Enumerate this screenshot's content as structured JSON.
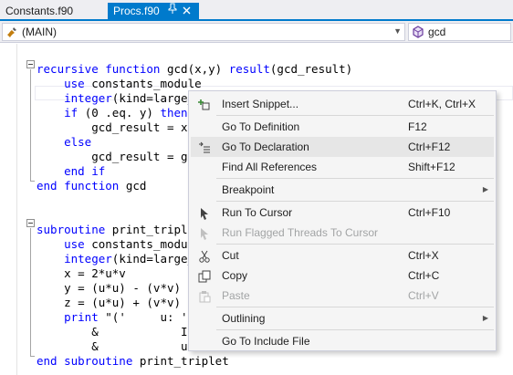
{
  "tabs": [
    {
      "label": "Constants.f90",
      "active": false
    },
    {
      "label": "Procs.f90",
      "active": true
    }
  ],
  "tab_icons": {
    "pin": "pin-icon",
    "close": "close-icon"
  },
  "navbar": {
    "scope": "(MAIN)",
    "member": "gcd"
  },
  "code_lines": [
    [],
    [
      {
        "t": "recursive function",
        "k": true
      },
      {
        "t": " gcd(x,y) "
      },
      {
        "t": "result",
        "k": true
      },
      {
        "t": "(gcd_result)"
      }
    ],
    [
      {
        "t": "    "
      },
      {
        "t": "use",
        "k": true
      },
      {
        "t": " constants_module"
      }
    ],
    [
      {
        "t": "    "
      },
      {
        "t": "integer",
        "k": true
      },
      {
        "t": "(kind=large_i"
      }
    ],
    [
      {
        "t": "    "
      },
      {
        "t": "if",
        "k": true
      },
      {
        "t": " (0 .eq. y) "
      },
      {
        "t": "then",
        "k": true
      }
    ],
    [
      {
        "t": "        gcd_result = x"
      }
    ],
    [
      {
        "t": "    "
      },
      {
        "t": "else",
        "k": true
      }
    ],
    [
      {
        "t": "        gcd_result = gcc"
      }
    ],
    [
      {
        "t": "    "
      },
      {
        "t": "end if",
        "k": true
      }
    ],
    [
      {
        "t": "end function",
        "k": true
      },
      {
        "t": " gcd"
      }
    ],
    [],
    [],
    [
      {
        "t": "subroutine",
        "k": true
      },
      {
        "t": " print_triplet"
      }
    ],
    [
      {
        "t": "    "
      },
      {
        "t": "use",
        "k": true
      },
      {
        "t": " constants_module"
      }
    ],
    [
      {
        "t": "    "
      },
      {
        "t": "integer",
        "k": true
      },
      {
        "t": "(kind=large_i"
      }
    ],
    [
      {
        "t": "    x = 2*u*v"
      }
    ],
    [
      {
        "t": "    y = (u*u) - (v*v)"
      }
    ],
    [
      {
        "t": "    z = (u*u) + (v*v)"
      }
    ],
    [
      {
        "t": "    "
      },
      {
        "t": "print",
        "k": true
      },
      {
        "t": " \"('     u: ',I"
      }
    ],
    [
      {
        "t": "        &            I"
      }
    ],
    [
      {
        "t": "        &            u"
      }
    ],
    [
      {
        "t": "end subroutine",
        "k": true
      },
      {
        "t": " print_triplet"
      }
    ]
  ],
  "context_menu": {
    "items": [
      {
        "type": "item",
        "name": "menu-insert-snippet",
        "icon": "insert-snippet-icon",
        "label": "Insert Snippet...",
        "shortcut": "Ctrl+K, Ctrl+X",
        "enabled": true
      },
      {
        "type": "separator"
      },
      {
        "type": "item",
        "name": "menu-go-to-definition",
        "icon": "",
        "label": "Go To Definition",
        "shortcut": "F12",
        "enabled": true
      },
      {
        "type": "item",
        "name": "menu-go-to-declaration",
        "icon": "go-to-declaration-icon",
        "label": "Go To Declaration",
        "shortcut": "Ctrl+F12",
        "enabled": true,
        "hover": true
      },
      {
        "type": "item",
        "name": "menu-find-all-references",
        "icon": "",
        "label": "Find All References",
        "shortcut": "Shift+F12",
        "enabled": true
      },
      {
        "type": "separator"
      },
      {
        "type": "item",
        "name": "menu-breakpoint",
        "icon": "",
        "label": "Breakpoint",
        "shortcut": "",
        "enabled": true,
        "submenu": true
      },
      {
        "type": "separator"
      },
      {
        "type": "item",
        "name": "menu-run-to-cursor",
        "icon": "run-to-cursor-icon",
        "label": "Run To Cursor",
        "shortcut": "Ctrl+F10",
        "enabled": true
      },
      {
        "type": "item",
        "name": "menu-run-flagged-threads",
        "icon": "run-flagged-threads-icon",
        "label": "Run Flagged Threads To Cursor",
        "shortcut": "",
        "enabled": false
      },
      {
        "type": "separator"
      },
      {
        "type": "item",
        "name": "menu-cut",
        "icon": "cut-icon",
        "label": "Cut",
        "shortcut": "Ctrl+X",
        "enabled": true
      },
      {
        "type": "item",
        "name": "menu-copy",
        "icon": "copy-icon",
        "label": "Copy",
        "shortcut": "Ctrl+C",
        "enabled": true
      },
      {
        "type": "item",
        "name": "menu-paste",
        "icon": "paste-icon",
        "label": "Paste",
        "shortcut": "Ctrl+V",
        "enabled": false
      },
      {
        "type": "separator"
      },
      {
        "type": "item",
        "name": "menu-outlining",
        "icon": "",
        "label": "Outlining",
        "shortcut": "",
        "enabled": true,
        "submenu": true
      },
      {
        "type": "separator"
      },
      {
        "type": "item",
        "name": "menu-go-to-include-file",
        "icon": "",
        "label": "Go To Include File",
        "shortcut": "",
        "enabled": true
      }
    ]
  }
}
